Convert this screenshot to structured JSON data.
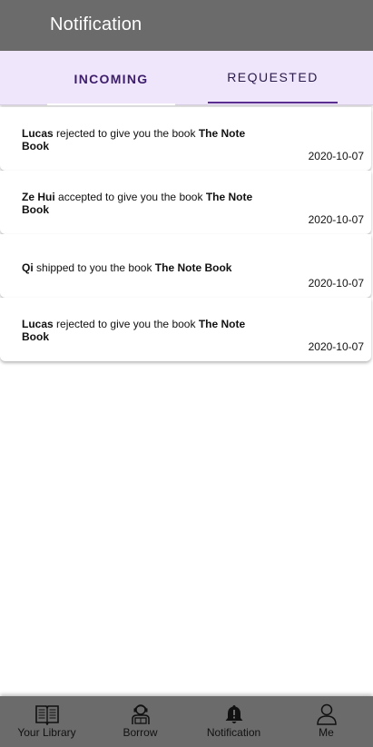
{
  "app_bar": {
    "title": "Notification"
  },
  "tabs": [
    {
      "label": "INCOMING"
    },
    {
      "label": "REQUESTED"
    }
  ],
  "notifications": [
    {
      "actor": "Lucas",
      "action": "rejected to give you the book",
      "book": "The Note Book",
      "date": "2020-10-07"
    },
    {
      "actor": "Ze Hui",
      "action": "accepted to give you the book",
      "book": "The Note Book",
      "date": "2020-10-07"
    },
    {
      "actor": "Qi",
      "action": "shipped to you the book",
      "book": "The Note Book",
      "date": "2020-10-07"
    },
    {
      "actor": "Lucas",
      "action": "rejected to give you the book",
      "book": "The Note Book",
      "date": "2020-10-07"
    }
  ],
  "bottom_nav": [
    {
      "label": "Your Library",
      "icon": "book-icon"
    },
    {
      "label": "Borrow",
      "icon": "borrow-person-icon"
    },
    {
      "label": "Notification",
      "icon": "bell-alert-icon"
    },
    {
      "label": "Me",
      "icon": "person-icon"
    }
  ]
}
